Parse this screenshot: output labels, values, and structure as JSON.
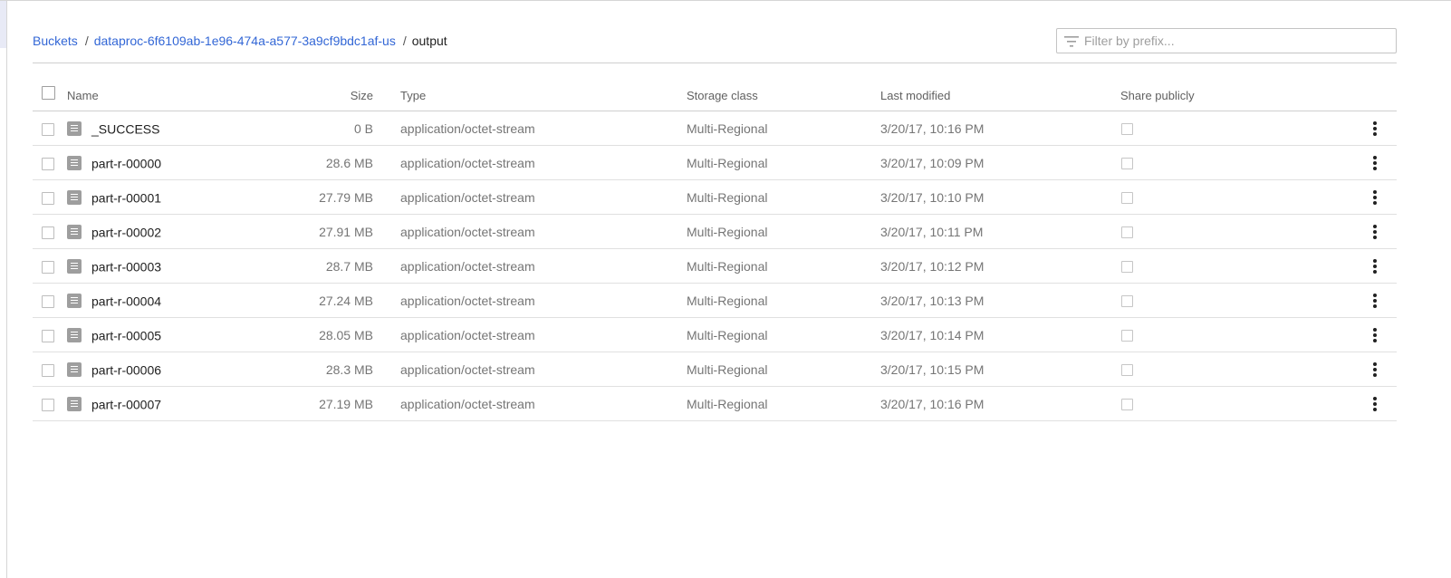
{
  "breadcrumb": {
    "root": "Buckets",
    "bucket": "dataproc-6f6109ab-1e96-474a-a577-3a9cf9bdc1af-us",
    "current": "output",
    "separator": "/"
  },
  "filter": {
    "placeholder": "Filter by prefix...",
    "value": ""
  },
  "columns": {
    "name": "Name",
    "size": "Size",
    "type": "Type",
    "storage_class": "Storage class",
    "last_modified": "Last modified",
    "share_publicly": "Share publicly"
  },
  "rows": [
    {
      "name": "_SUCCESS",
      "size": "0 B",
      "type": "application/octet-stream",
      "storage_class": "Multi-Regional",
      "last_modified": "3/20/17, 10:16 PM"
    },
    {
      "name": "part-r-00000",
      "size": "28.6 MB",
      "type": "application/octet-stream",
      "storage_class": "Multi-Regional",
      "last_modified": "3/20/17, 10:09 PM"
    },
    {
      "name": "part-r-00001",
      "size": "27.79 MB",
      "type": "application/octet-stream",
      "storage_class": "Multi-Regional",
      "last_modified": "3/20/17, 10:10 PM"
    },
    {
      "name": "part-r-00002",
      "size": "27.91 MB",
      "type": "application/octet-stream",
      "storage_class": "Multi-Regional",
      "last_modified": "3/20/17, 10:11 PM"
    },
    {
      "name": "part-r-00003",
      "size": "28.7 MB",
      "type": "application/octet-stream",
      "storage_class": "Multi-Regional",
      "last_modified": "3/20/17, 10:12 PM"
    },
    {
      "name": "part-r-00004",
      "size": "27.24 MB",
      "type": "application/octet-stream",
      "storage_class": "Multi-Regional",
      "last_modified": "3/20/17, 10:13 PM"
    },
    {
      "name": "part-r-00005",
      "size": "28.05 MB",
      "type": "application/octet-stream",
      "storage_class": "Multi-Regional",
      "last_modified": "3/20/17, 10:14 PM"
    },
    {
      "name": "part-r-00006",
      "size": "28.3 MB",
      "type": "application/octet-stream",
      "storage_class": "Multi-Regional",
      "last_modified": "3/20/17, 10:15 PM"
    },
    {
      "name": "part-r-00007",
      "size": "27.19 MB",
      "type": "application/octet-stream",
      "storage_class": "Multi-Regional",
      "last_modified": "3/20/17, 10:16 PM"
    }
  ],
  "colors": {
    "link": "#3367d6",
    "file_icon": "#9e9e9e"
  },
  "icons": {
    "filter": "filter-icon",
    "file": "file-icon",
    "row_menu": "more-vert-icon"
  }
}
